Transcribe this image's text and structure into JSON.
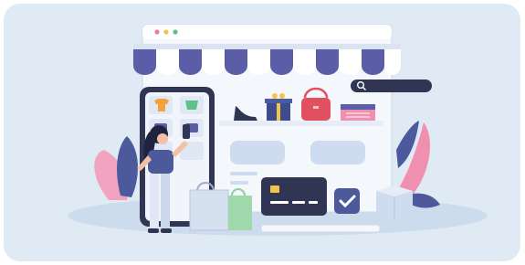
{
  "scene": {
    "description_free": true,
    "colors": {
      "background": "#dfeaf5",
      "accent_purple": "#5b5ea6",
      "dark_navy": "#2f3552",
      "pink": "#f08fb0",
      "white": "#ffffff"
    },
    "icons": [
      "search-icon",
      "check-icon",
      "gift-icon",
      "shoe-icon",
      "handbag-icon",
      "credit-card-icon",
      "shopping-bag-icon",
      "tshirt-icon"
    ]
  },
  "search": {
    "placeholder": ""
  }
}
